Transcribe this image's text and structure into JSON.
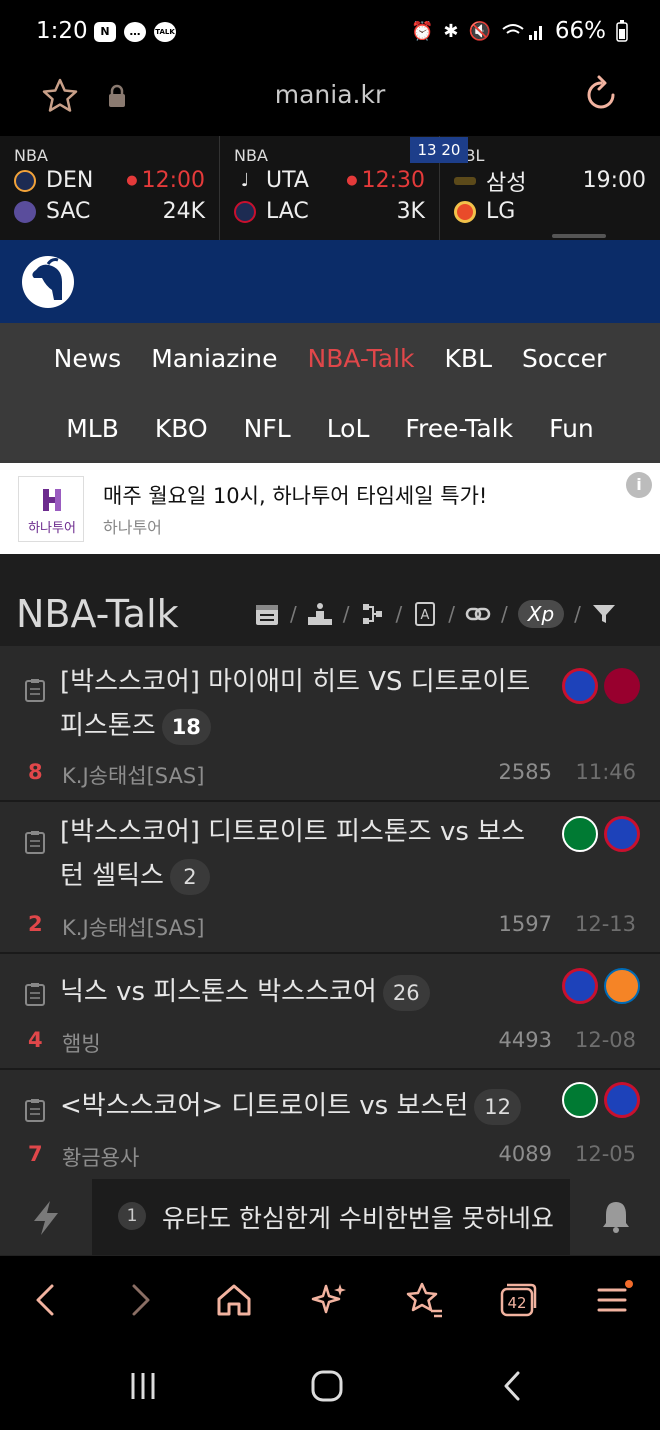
{
  "status_bar": {
    "time": "1:20",
    "notif_icons": [
      "N",
      "…",
      "TALK"
    ],
    "battery": "66%"
  },
  "browser": {
    "url": "mania.kr"
  },
  "scores": {
    "badge": "13 20",
    "games": [
      {
        "league": "NBA",
        "home": "DEN",
        "away": "SAC",
        "status": "12:00",
        "status_live": true,
        "viewers": "24K",
        "home_color": "#f2a33a",
        "away_color": "#8a7fc9"
      },
      {
        "league": "NBA",
        "home": "UTA",
        "away": "LAC",
        "status": "12:30",
        "status_live": true,
        "viewers": "3K",
        "home_color": "#e8e8e8",
        "away_color": "#c8102e"
      },
      {
        "league": "KBL",
        "home": "삼성",
        "away": "LG",
        "status": "19:00",
        "status_live": false,
        "viewers": "",
        "home_color": "#d9b23a",
        "away_color": "#e94b2a"
      }
    ]
  },
  "nav": {
    "row1": [
      "News",
      "Maniazine",
      "NBA-Talk",
      "KBL",
      "Soccer"
    ],
    "row2": [
      "MLB",
      "KBO",
      "NFL",
      "LoL",
      "Free-Talk",
      "Fun"
    ],
    "active": "NBA-Talk"
  },
  "ad": {
    "brand": "하나투어",
    "title": "매주 월요일 10시, 하나투어 타임세일 특가!",
    "sponsor": "하나투어",
    "info": "i"
  },
  "board": {
    "title": "NBA-Talk",
    "xp": "Xp",
    "posts": [
      {
        "title": "[박스스코어] 마이애미 히트 VS 디트로이트 피스톤즈",
        "comments": "18",
        "rank": "8",
        "author": "K.J송태섭[SAS]",
        "views": "2585",
        "date": "11:46",
        "logos": [
          "DETROIT PISTONS",
          "HEAT"
        ]
      },
      {
        "title": "[박스스코어] 디트로이트 피스톤즈 vs 보스턴 셀틱스",
        "comments": "2",
        "rank": "2",
        "author": "K.J송태섭[SAS]",
        "views": "1597",
        "date": "12-13",
        "logos": [
          "CELTICS",
          "DETROIT PISTONS"
        ]
      },
      {
        "title": "닉스 vs 피스톤스 박스스코어",
        "comments": "26",
        "rank": "4",
        "author": "햄빙",
        "views": "4493",
        "date": "12-08",
        "logos": [
          "DETROIT PISTONS",
          "KNICKS"
        ]
      },
      {
        "title": "<박스스코어> 디트로이트 vs 보스턴",
        "comments": "12",
        "rank": "7",
        "author": "황금용사",
        "views": "4089",
        "date": "12-05",
        "logos": [
          "CELTICS",
          "DETROIT PISTONS"
        ]
      }
    ]
  },
  "ticker": {
    "number": "1",
    "text": "유타도 한심한게 수비한번을 못하네요"
  },
  "toolbar": {
    "tabs_count": "42"
  }
}
